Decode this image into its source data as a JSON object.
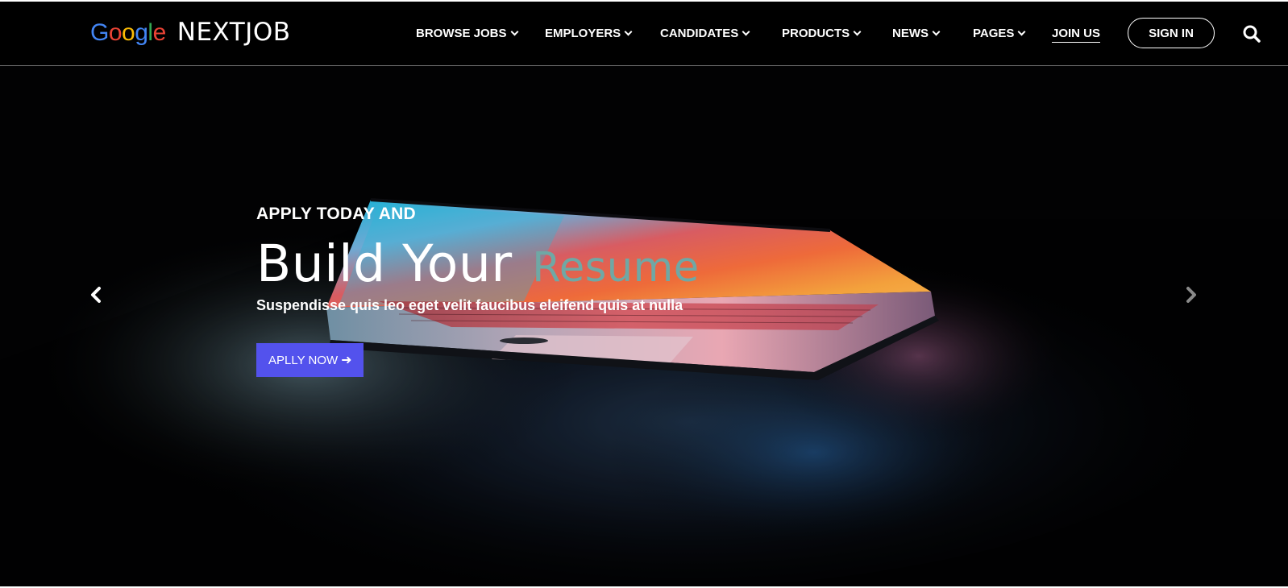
{
  "brand": {
    "google_letters": [
      {
        "char": "G",
        "color": "#4285F4"
      },
      {
        "char": "o",
        "color": "#EA4335"
      },
      {
        "char": "o",
        "color": "#FBBC05"
      },
      {
        "char": "g",
        "color": "#4285F4"
      },
      {
        "char": "l",
        "color": "#34A853"
      },
      {
        "char": "e",
        "color": "#EA4335"
      }
    ],
    "name": "NEXTJOB"
  },
  "nav": {
    "items": [
      {
        "label": "BROWSE JOBS",
        "dropdown": true
      },
      {
        "label": "EMPLOYERS",
        "dropdown": true
      },
      {
        "label": "CANDIDATES",
        "dropdown": true
      },
      {
        "label": "PRODUCTS",
        "dropdown": true
      },
      {
        "label": "NEWS",
        "dropdown": true
      },
      {
        "label": "PAGES",
        "dropdown": true
      }
    ],
    "join_label": "JOIN US",
    "signin_label": "SIGN IN",
    "search_icon": "search-icon"
  },
  "hero": {
    "eyebrow": "APPLY TODAY AND",
    "headline_main": "Build Your",
    "headline_accent": "Resume",
    "subline": "Suspendisse quis leo eget velit faucibus eleifend quis at nulla",
    "cta_label": "APLLY NOW",
    "cta_icon": "arrow-right-icon",
    "prev_icon": "chevron-left-icon",
    "next_icon": "chevron-right-icon"
  },
  "colors": {
    "accent_text": "#6fa8a5",
    "cta_background": "#5352ed",
    "nav_background": "#000000"
  }
}
